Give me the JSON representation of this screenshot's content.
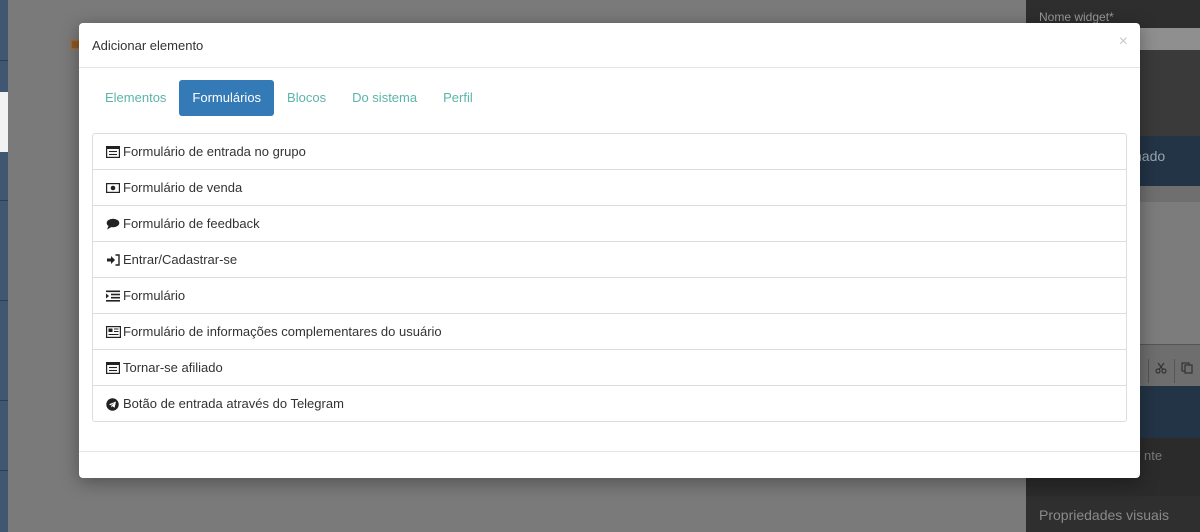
{
  "background": {
    "right_panel": {
      "widget_name_label": "Nome widget*",
      "band_text": "nado",
      "toolbar_icons": [
        "scissors-icon",
        "copy-icon"
      ],
      "partial_text": "nte",
      "visual_props_label": "Propriedades visuais"
    }
  },
  "modal": {
    "title": "Adicionar elemento",
    "close_label": "×",
    "tabs": [
      {
        "label": "Elementos",
        "active": false
      },
      {
        "label": "Formulários",
        "active": true
      },
      {
        "label": "Blocos",
        "active": false
      },
      {
        "label": "Do sistema",
        "active": false
      },
      {
        "label": "Perfil",
        "active": false
      }
    ],
    "items": [
      {
        "icon": "list-alt-icon",
        "label": "Formulário de entrada no grupo"
      },
      {
        "icon": "money-icon",
        "label": "Formulário de venda"
      },
      {
        "icon": "comment-icon",
        "label": "Formulário de feedback"
      },
      {
        "icon": "sign-in-icon",
        "label": "Entrar/Cadastrar-se"
      },
      {
        "icon": "indent-icon",
        "label": "Formulário"
      },
      {
        "icon": "newspaper-icon",
        "label": "Formulário de informações complementares do usuário"
      },
      {
        "icon": "list-alt-icon",
        "label": "Tornar-se afiliado"
      },
      {
        "icon": "telegram-icon",
        "label": "Botão de entrada através do Telegram"
      }
    ]
  },
  "colors": {
    "tab_active_bg": "#337ab7",
    "tab_text": "#5bb5a8",
    "overlay": "#7a7a7a"
  }
}
